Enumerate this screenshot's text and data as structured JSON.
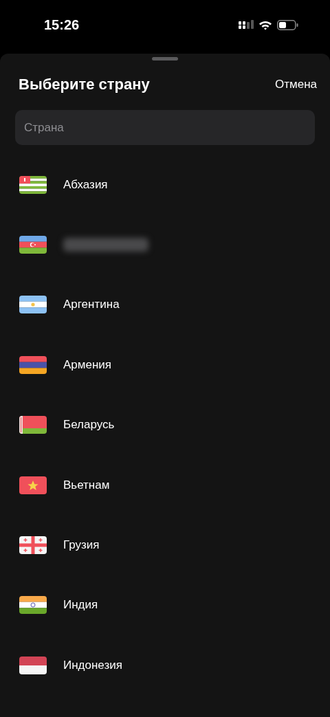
{
  "status_bar": {
    "time": "15:26"
  },
  "sheet": {
    "title": "Выберите страну",
    "cancel": "Отмена"
  },
  "search": {
    "placeholder": "Страна"
  },
  "countries": [
    {
      "kind": "abkhazia",
      "name": "Абхазия"
    },
    {
      "kind": "azerbaijan",
      "redacted": true
    },
    {
      "kind": "argentina",
      "name": "Аргентина"
    },
    {
      "kind": "armenia",
      "name": "Армения"
    },
    {
      "kind": "belarus",
      "name": "Беларусь"
    },
    {
      "kind": "vietnam",
      "name": "Вьетнам"
    },
    {
      "kind": "georgia",
      "name": "Грузия"
    },
    {
      "kind": "india",
      "name": "Индия"
    },
    {
      "kind": "indonesia",
      "name": "Индонезия"
    }
  ]
}
